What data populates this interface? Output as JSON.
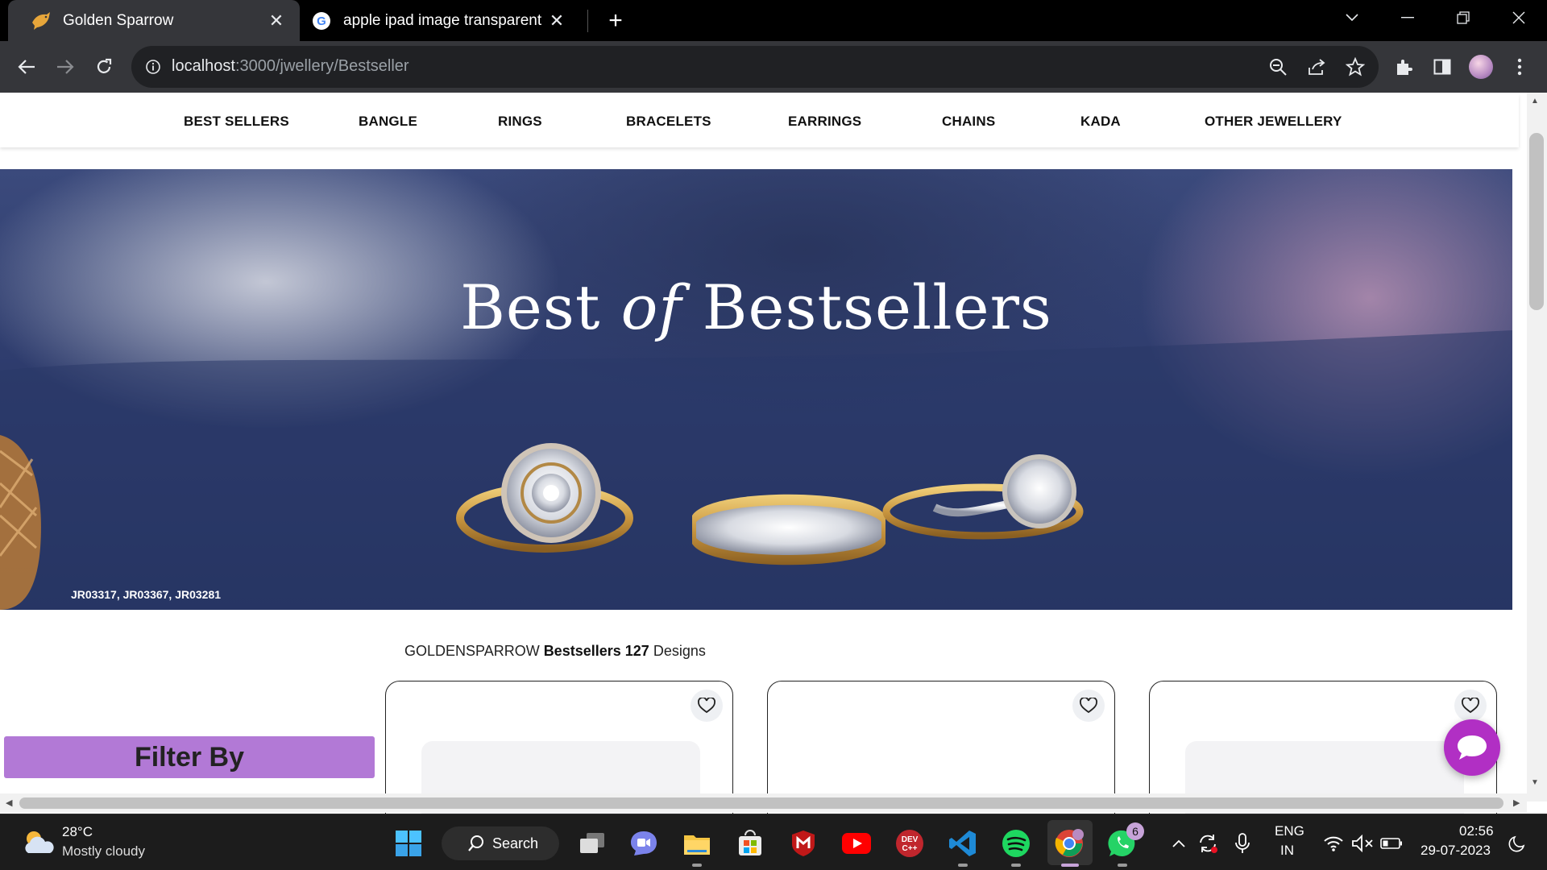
{
  "browser": {
    "tabs": [
      {
        "title": "Golden Sparrow",
        "favicon": "sparrow-icon",
        "active": true
      },
      {
        "title": "apple ipad image transparent ba",
        "favicon": "google-icon",
        "active": false
      }
    ],
    "url_host": "localhost",
    "url_path": ":3000/jwellery/Bestseller"
  },
  "site": {
    "nav": [
      "BEST SELLERS",
      "BANGLE",
      "RINGS",
      "BRACELETS",
      "EARRINGS",
      "CHAINS",
      "KADA",
      "OTHER JEWELLERY"
    ],
    "banner": {
      "title_part1": "Best ",
      "title_part2": "of",
      "title_part3": " Bestsellers",
      "codes": "JR03317, JR03367, JR03281"
    },
    "count_line": {
      "brand": "GOLDENSPARROW ",
      "category": "Bestsellers",
      "count": " 127",
      "suffix": " Designs"
    },
    "filter_label": "Filter By",
    "accent_color": "#b279d6",
    "chat_color": "#b12fc4"
  },
  "taskbar": {
    "weather_temp": "28°C",
    "weather_desc": "Mostly cloudy",
    "search_label": "Search",
    "whatsapp_badge": "6",
    "lang_line1": "ENG",
    "lang_line2": "IN",
    "time": "02:56",
    "date": "29-07-2023"
  }
}
